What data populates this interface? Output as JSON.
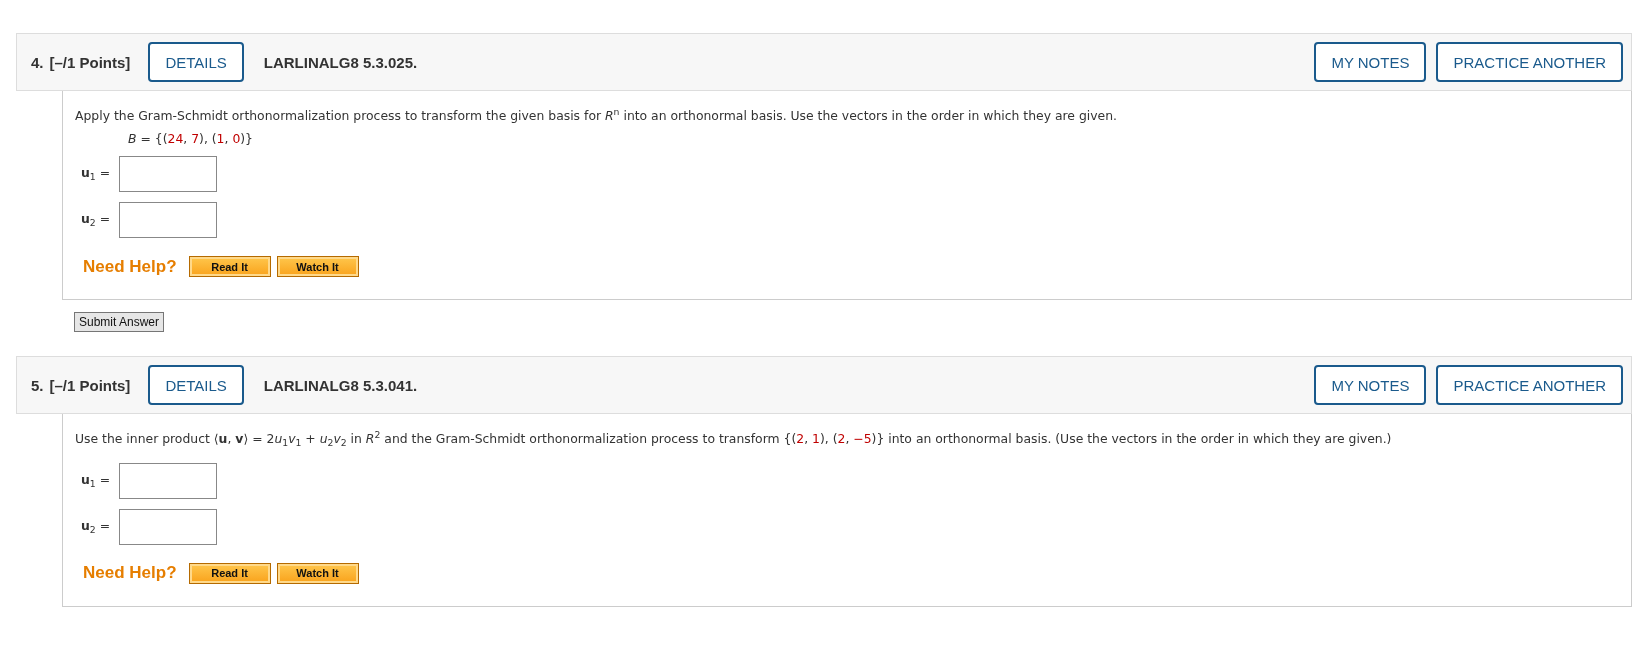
{
  "questions": [
    {
      "number": "4.",
      "points": "[–/1 Points]",
      "details_button": "DETAILS",
      "code": "LARLINALG8 5.3.025.",
      "notes_button": "MY NOTES",
      "practice_button": "PRACTICE ANOTHER",
      "prompt": [
        {
          "kind": "plain",
          "text": "Apply the Gram-Schmidt orthonormalization process to transform the given basis for *R*$^{n}$ into an orthonormal basis. Use the vectors in the order in which they are given."
        }
      ],
      "formula": [
        {
          "kind": "plain",
          "text": "*B* = {("
        },
        {
          "kind": "number",
          "text": "24"
        },
        {
          "kind": "plain",
          "text": ", "
        },
        {
          "kind": "number",
          "text": "7"
        },
        {
          "kind": "plain",
          "text": "), ("
        },
        {
          "kind": "number",
          "text": "1"
        },
        {
          "kind": "plain",
          "text": ", "
        },
        {
          "kind": "number",
          "text": "0"
        },
        {
          "kind": "plain",
          "text": ")}"
        }
      ],
      "answers": [
        {
          "label": "**u**$_{1}$ ="
        },
        {
          "label": "**u**$_{2}$ ="
        }
      ],
      "help": {
        "label": "Need Help?",
        "buttons": [
          "Read It",
          "Watch It"
        ]
      },
      "submit_button": "Submit Answer"
    },
    {
      "number": "5.",
      "points": "[–/1 Points]",
      "details_button": "DETAILS",
      "code": "LARLINALG8 5.3.041.",
      "notes_button": "MY NOTES",
      "practice_button": "PRACTICE ANOTHER",
      "prompt": [
        {
          "kind": "plain",
          "text": "Use the inner product  ⟨**u**, **v**⟩ = 2"
        },
        {
          "kind": "plain",
          "text": "*u*$_{1}$*v*$_{1}$ + *u*$_{2}$*v*$_{2}$  in *R*$^{2}$ and the Gram-Schmidt orthonormalization process to transform  {("
        },
        {
          "kind": "number",
          "text": "2"
        },
        {
          "kind": "plain",
          "text": ", "
        },
        {
          "kind": "number",
          "text": "1"
        },
        {
          "kind": "plain",
          "text": "), ("
        },
        {
          "kind": "number",
          "text": "2"
        },
        {
          "kind": "plain",
          "text": ", "
        },
        {
          "kind": "number",
          "text": "−5"
        },
        {
          "kind": "plain",
          "text": ")}  into an orthonormal basis. (Use the vectors in the order in which they are given.)"
        }
      ],
      "answers": [
        {
          "label": "**u**$_{1}$ ="
        },
        {
          "label": "**u**$_{2}$ ="
        }
      ],
      "help": {
        "label": "Need Help?",
        "buttons": [
          "Read It",
          "Watch It"
        ]
      }
    }
  ]
}
